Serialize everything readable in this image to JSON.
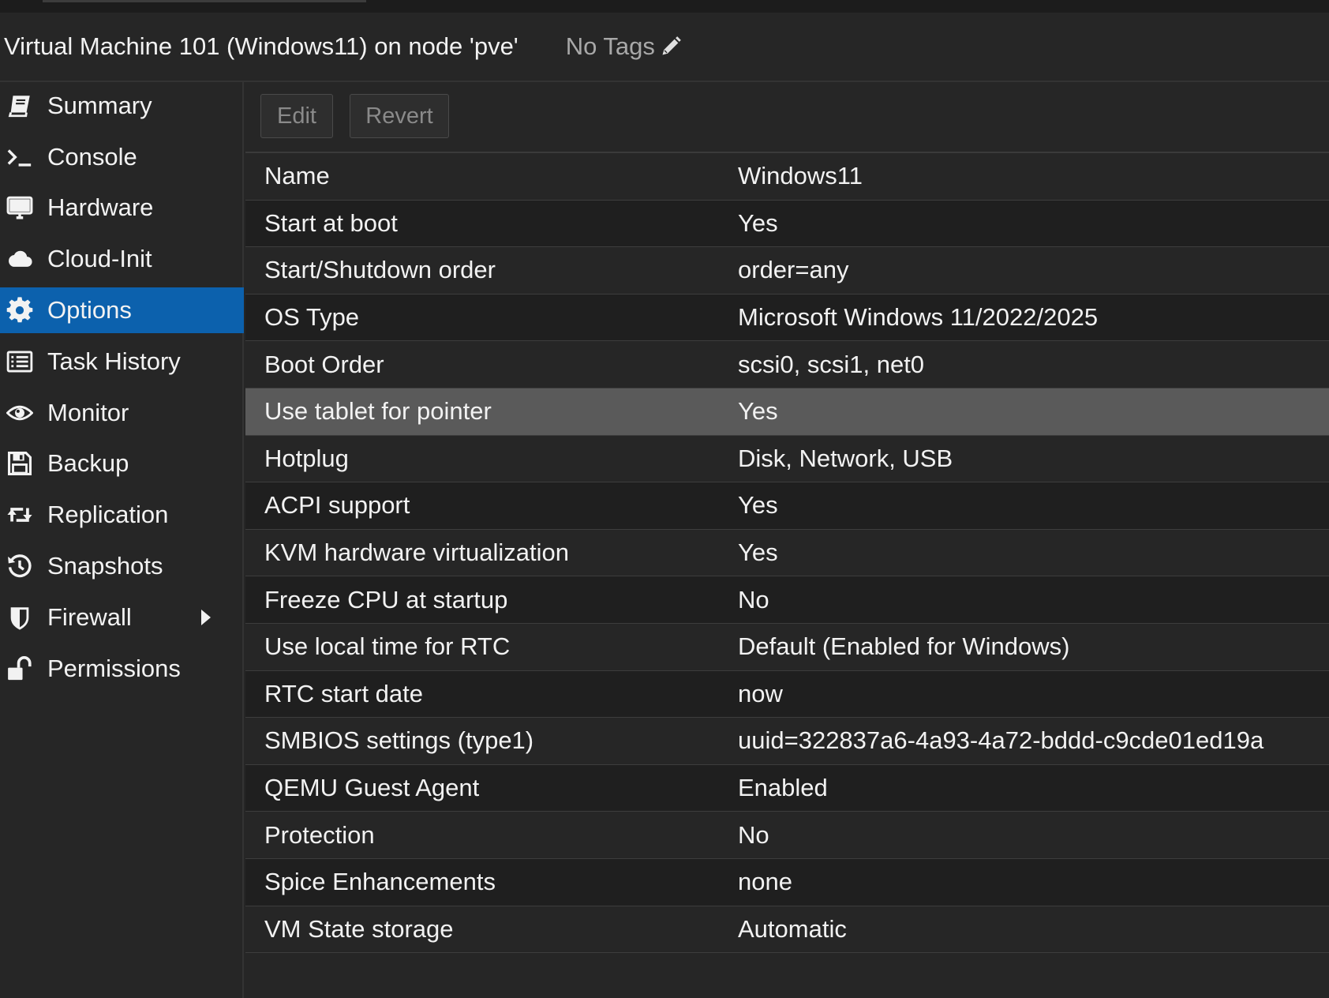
{
  "header": {
    "title": "Virtual Machine 101 (Windows11) on node 'pve'",
    "tags_label": "No Tags",
    "tags_icon": "pencil-icon"
  },
  "sidebar": {
    "active_color": "#0c61ad",
    "items": [
      {
        "label": "Summary",
        "icon": "book-icon",
        "active": false
      },
      {
        "label": "Console",
        "icon": "terminal-icon",
        "active": false
      },
      {
        "label": "Hardware",
        "icon": "monitor-icon",
        "active": false
      },
      {
        "label": "Cloud-Init",
        "icon": "cloud-icon",
        "active": false
      },
      {
        "label": "Options",
        "icon": "gear-icon",
        "active": true
      },
      {
        "label": "Task History",
        "icon": "list-icon",
        "active": false
      },
      {
        "label": "Monitor",
        "icon": "eye-icon",
        "active": false
      },
      {
        "label": "Backup",
        "icon": "floppy-icon",
        "active": false
      },
      {
        "label": "Replication",
        "icon": "retweet-icon",
        "active": false
      },
      {
        "label": "Snapshots",
        "icon": "history-icon",
        "active": false
      },
      {
        "label": "Firewall",
        "icon": "shield-icon",
        "active": false,
        "has_submenu": true
      },
      {
        "label": "Permissions",
        "icon": "unlock-icon",
        "active": false
      }
    ]
  },
  "toolbar": {
    "edit_label": "Edit",
    "revert_label": "Revert"
  },
  "options": {
    "selected_row": "Use tablet for pointer",
    "rows": [
      {
        "name": "Name",
        "value": "Windows11"
      },
      {
        "name": "Start at boot",
        "value": "Yes"
      },
      {
        "name": "Start/Shutdown order",
        "value": "order=any"
      },
      {
        "name": "OS Type",
        "value": "Microsoft Windows 11/2022/2025"
      },
      {
        "name": "Boot Order",
        "value": "scsi0, scsi1, net0"
      },
      {
        "name": "Use tablet for pointer",
        "value": "Yes"
      },
      {
        "name": "Hotplug",
        "value": "Disk, Network, USB"
      },
      {
        "name": "ACPI support",
        "value": "Yes"
      },
      {
        "name": "KVM hardware virtualization",
        "value": "Yes"
      },
      {
        "name": "Freeze CPU at startup",
        "value": "No"
      },
      {
        "name": "Use local time for RTC",
        "value": "Default (Enabled for Windows)"
      },
      {
        "name": "RTC start date",
        "value": "now"
      },
      {
        "name": "SMBIOS settings (type1)",
        "value": "uuid=322837a6-4a93-4a72-bddd-c9cde01ed19a"
      },
      {
        "name": "QEMU Guest Agent",
        "value": "Enabled"
      },
      {
        "name": "Protection",
        "value": "No"
      },
      {
        "name": "Spice Enhancements",
        "value": "none"
      },
      {
        "name": "VM State storage",
        "value": "Automatic"
      }
    ]
  }
}
